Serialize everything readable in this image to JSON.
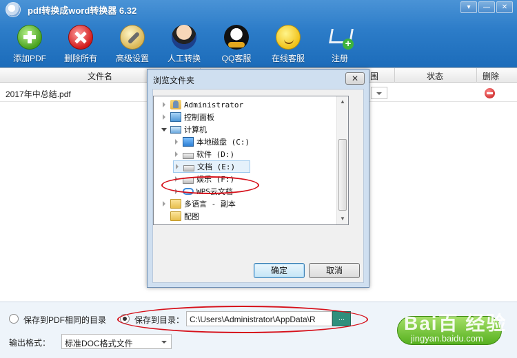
{
  "window": {
    "title": "pdf转换成word转换器 6.32"
  },
  "toolbar": [
    {
      "label": "添加PDF",
      "icon": "add-icon"
    },
    {
      "label": "删除所有",
      "icon": "delete-icon"
    },
    {
      "label": "高级设置",
      "icon": "wrench-icon"
    },
    {
      "label": "人工转换",
      "icon": "person-icon"
    },
    {
      "label": "QQ客服",
      "icon": "qq-penguin-icon"
    },
    {
      "label": "在线客服",
      "icon": "smiley-headset-icon"
    },
    {
      "label": "注册",
      "icon": "cart-icon"
    }
  ],
  "table": {
    "columns": [
      "文件名",
      "围",
      "状态",
      "删除"
    ],
    "rows": [
      {
        "filename": "2017年中总结.pdf"
      }
    ]
  },
  "dialog": {
    "title": "浏览文件夹",
    "close": "✕",
    "tree": [
      {
        "label": "Administrator"
      },
      {
        "label": "控制面板"
      },
      {
        "label": "计算机"
      },
      {
        "label": "本地磁盘 (C:)"
      },
      {
        "label": "软件 (D:)"
      },
      {
        "label": "文档 (E:)"
      },
      {
        "label": "娱乐 (F:)"
      },
      {
        "label": "WPS云文档"
      },
      {
        "label": "多语言 - 副本"
      },
      {
        "label": "配图"
      }
    ],
    "ok": "确定",
    "cancel": "取消"
  },
  "bottom": {
    "save_same_dir": "保存到PDF相同的目录",
    "save_to_dir": "保存到目录：",
    "path": "C:\\Users\\Administrator\\AppData\\R",
    "browse": "...",
    "format_label": "输出格式：",
    "format_value": "标准DOC格式文件"
  },
  "watermark": {
    "brand": "Bai百 经验",
    "url": "jingyan.baidu.com"
  },
  "colors": {
    "header_blue": "#2c7cc8",
    "highlight_red": "#d6101a",
    "start_green": "#56b01f"
  }
}
